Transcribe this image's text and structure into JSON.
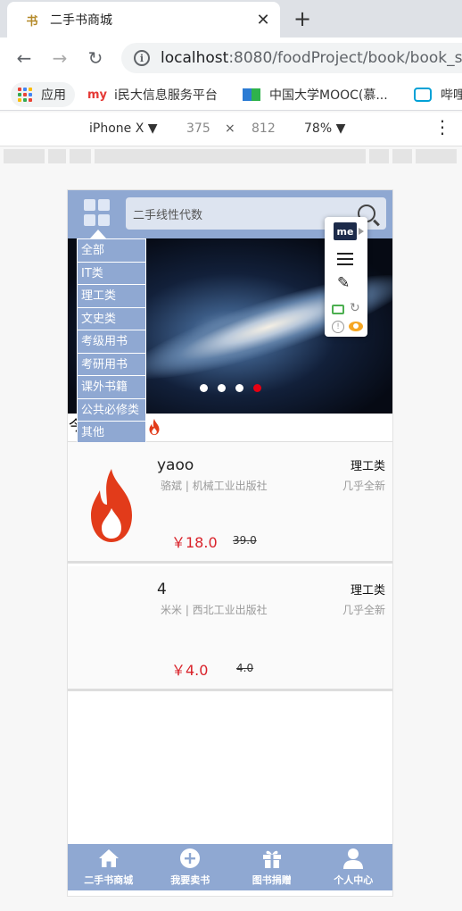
{
  "browser": {
    "tab_title": "二手书商城",
    "tab_favicon": "书",
    "url_host": "localhost",
    "url_path": ":8080/foodProject/book/book_s",
    "bookmarks": [
      {
        "label": "应用"
      },
      {
        "label": "i民大信息服务平台",
        "badge": "my"
      },
      {
        "label": "中国大学MOOC(慕..."
      },
      {
        "label": "哔哩"
      }
    ]
  },
  "devtools": {
    "device": "iPhone X",
    "width": "375",
    "height": "812",
    "zoom": "78%"
  },
  "app": {
    "search_placeholder": "二手线性代数",
    "category_menu": [
      "全部",
      "IT类",
      "理工类",
      "文史类",
      "考级用书",
      "考研用书",
      "课外书籍",
      "公共必修类",
      "其他"
    ],
    "hot_label": "今",
    "carousel": {
      "slides": 4,
      "active_index": 3
    },
    "books": [
      {
        "title": "yaoo",
        "author": "骆斌",
        "publisher": "机械工业出版社",
        "meta": "骆斌 | 机械工业出版社",
        "category": "理工类",
        "condition": "几乎全新",
        "price": "￥18.0",
        "original_price": "39.0",
        "has_image": true
      },
      {
        "title": "4",
        "author": "米米",
        "publisher": "西北工业出版社",
        "meta": "米米 | 西北工业出版社",
        "category": "理工类",
        "condition": "几乎全新",
        "price": "￥4.0",
        "original_price": "4.0",
        "has_image": false
      }
    ],
    "bottom_nav": [
      {
        "label": "二手书商城",
        "icon": "home-icon"
      },
      {
        "label": "我要卖书",
        "icon": "plus-circle-icon"
      },
      {
        "label": "图书捐赠",
        "icon": "gift-icon"
      },
      {
        "label": "个人中心",
        "icon": "user-icon"
      }
    ]
  },
  "colors": {
    "header": "#8fa8d2",
    "price": "#d9222a",
    "flame": "#e23b1a",
    "active_dot": "#e60012"
  }
}
